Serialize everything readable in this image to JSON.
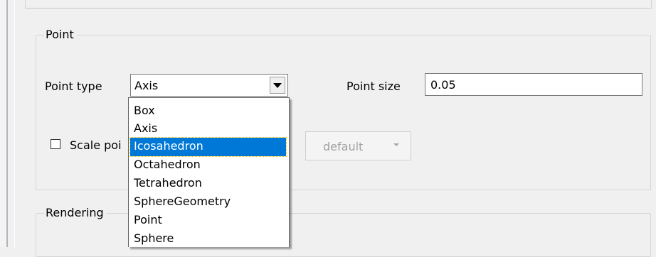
{
  "point_group": {
    "title": "Point",
    "point_type_label": "Point type",
    "point_type_value": "Axis",
    "point_size_label": "Point size",
    "point_size_value": "0.05",
    "scale_label": "Scale poi",
    "scale_checked": false,
    "default_label": "default"
  },
  "rendering_group": {
    "title": "Rendering"
  },
  "dropdown": {
    "items": [
      "Box",
      "Axis",
      "Icosahedron",
      "Octahedron",
      "Tetrahedron",
      "SphereGeometry",
      "Point",
      "Sphere"
    ],
    "highlighted": "Icosahedron"
  },
  "colors": {
    "selection": "#0078d7",
    "background": "#f0f0f0"
  },
  "icons": {
    "combo_arrow": "chevron-down-icon",
    "default_arrow": "caret-down-icon"
  }
}
